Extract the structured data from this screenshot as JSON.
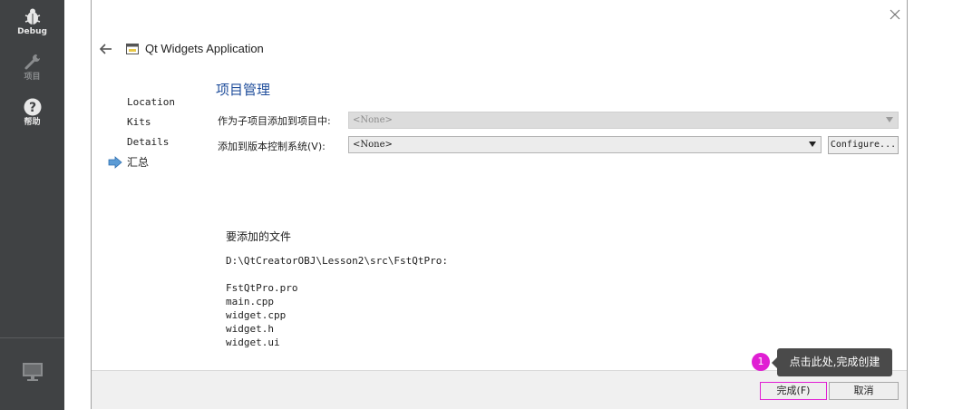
{
  "sidebar": {
    "modes": [
      {
        "label": "Debug",
        "icon": "bug-icon"
      },
      {
        "label": "项目",
        "icon": "wrench-icon"
      },
      {
        "label": "帮助",
        "icon": "help-icon"
      }
    ],
    "bottom_icon": "monitor-icon"
  },
  "dialog": {
    "title": "Qt Widgets Application",
    "steps": [
      "Location",
      "Kits",
      "Details",
      "汇总"
    ],
    "current_step": "汇总",
    "section_title": "项目管理",
    "subproject_label": "作为子项目添加到项目中:",
    "subproject_value": "<None>",
    "vcs_label": "添加到版本控制系统(V):",
    "vcs_value": "<None>",
    "configure_label": "Configure...",
    "files_heading": "要添加的文件",
    "files_path": "D:\\QtCreatorOBJ\\Lesson2\\src\\FstQtPro:",
    "files": [
      "FstQtPro.pro",
      "main.cpp",
      "widget.cpp",
      "widget.h",
      "widget.ui"
    ],
    "finish_label": "完成(F)",
    "cancel_label": "取消"
  },
  "annotation": {
    "badge": "1",
    "tooltip": "点击此处,完成创建",
    "color": "#e01fd3"
  }
}
